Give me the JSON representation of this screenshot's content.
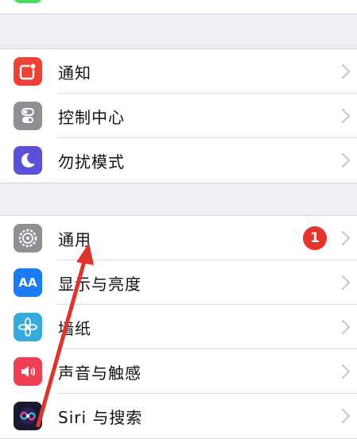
{
  "colors": {
    "group_background": "#efeff4",
    "cell_background": "#ffffff",
    "annotation_arrow": "#e0332b",
    "badge": "#e8322c"
  },
  "groups": [
    {
      "items": [
        {
          "label": "通知",
          "icon": "notifications-icon",
          "color": "#ee4237"
        },
        {
          "label": "控制中心",
          "icon": "control-center-icon",
          "color": "#8e8e93"
        },
        {
          "label": "勿扰模式",
          "icon": "do-not-disturb-icon",
          "color": "#5b51d8"
        }
      ]
    },
    {
      "items": [
        {
          "label": "通用",
          "icon": "general-gear-icon",
          "color": "#8e8e93",
          "badge": "1"
        },
        {
          "label": "显示与亮度",
          "icon": "display-brightness-icon",
          "color": "#1a7cf5",
          "icon_text": "AA"
        },
        {
          "label": "墙纸",
          "icon": "wallpaper-icon",
          "color": "#37a9dc"
        },
        {
          "label": "声音与触感",
          "icon": "sounds-icon",
          "color": "#ee3f54"
        },
        {
          "label": "Siri 与搜索",
          "icon": "siri-icon",
          "color": "#1a1a2e"
        }
      ]
    }
  ]
}
